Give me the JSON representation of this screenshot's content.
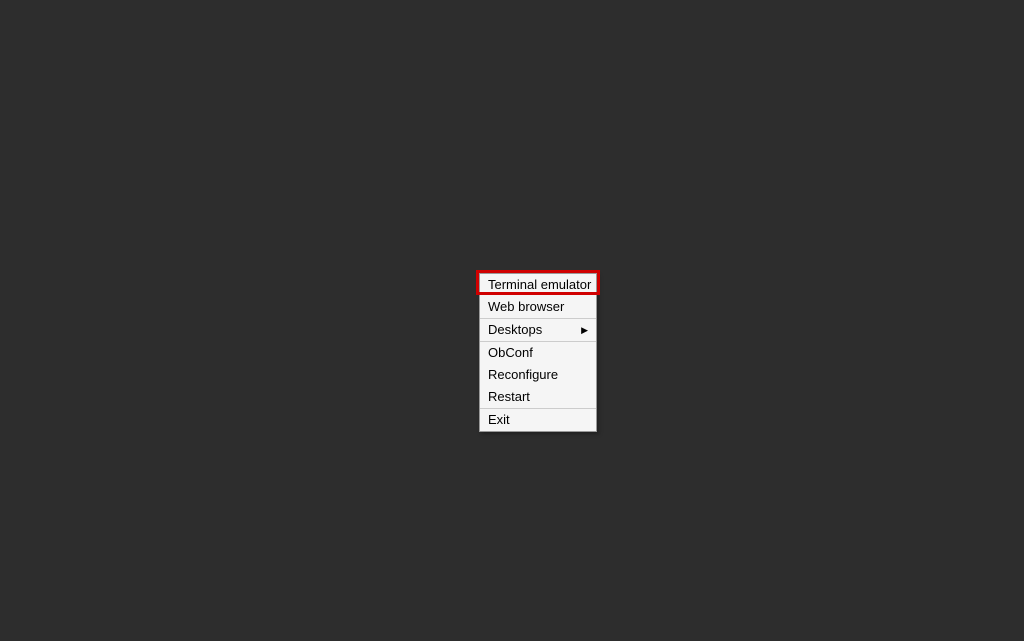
{
  "menu": {
    "sections": [
      {
        "items": [
          {
            "label": "Terminal emulator",
            "has_submenu": false
          },
          {
            "label": "Web browser",
            "has_submenu": false
          }
        ]
      },
      {
        "items": [
          {
            "label": "Desktops",
            "has_submenu": true
          }
        ]
      },
      {
        "items": [
          {
            "label": "ObConf",
            "has_submenu": false
          },
          {
            "label": "Reconfigure",
            "has_submenu": false
          },
          {
            "label": "Restart",
            "has_submenu": false
          }
        ]
      },
      {
        "items": [
          {
            "label": "Exit",
            "has_submenu": false
          }
        ]
      }
    ]
  },
  "submenu_arrow": "▶"
}
